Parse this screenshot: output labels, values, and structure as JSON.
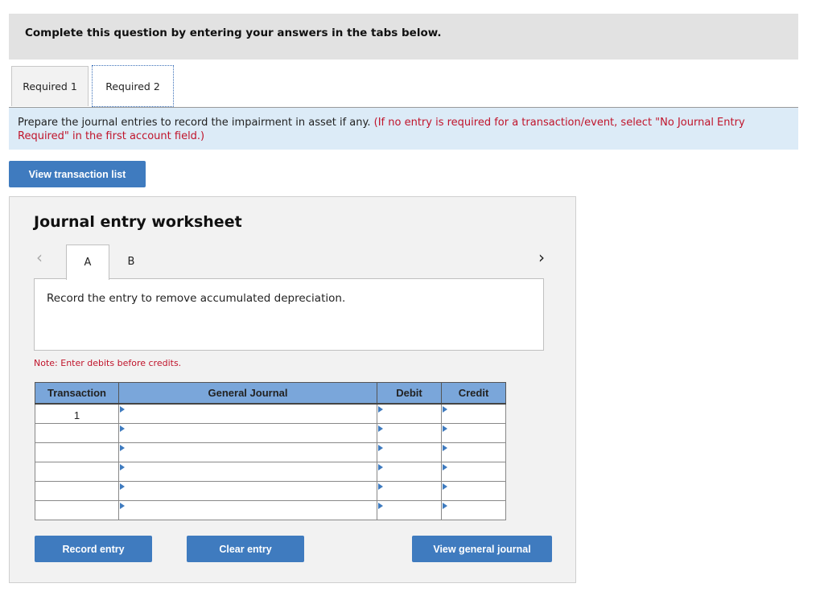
{
  "banner": {
    "text": "Complete this question by entering your answers in the tabs below."
  },
  "required_tabs": [
    {
      "label": "Required 1",
      "active": false
    },
    {
      "label": "Required 2",
      "active": true
    }
  ],
  "instructions": {
    "main": "Prepare the journal entries to record the impairment in asset if any.",
    "note": "(If no entry is required for a transaction/event, select \"No Journal Entry Required\" in the first account field.)"
  },
  "buttons": {
    "view_transaction_list": "View transaction list",
    "record_entry": "Record entry",
    "clear_entry": "Clear entry",
    "view_general_journal": "View general journal"
  },
  "worksheet": {
    "title": "Journal entry worksheet",
    "nav_prev": "<",
    "nav_next": ">",
    "tabs": [
      {
        "label": "A",
        "active": true
      },
      {
        "label": "B",
        "active": false
      }
    ],
    "description": "Record the entry to remove accumulated depreciation.",
    "note": "Note: Enter debits before credits."
  },
  "journal_table": {
    "headers": [
      "Transaction",
      "General Journal",
      "Debit",
      "Credit"
    ],
    "rows": [
      {
        "transaction": "1",
        "account": "",
        "debit": "",
        "credit": ""
      },
      {
        "transaction": "",
        "account": "",
        "debit": "",
        "credit": ""
      },
      {
        "transaction": "",
        "account": "",
        "debit": "",
        "credit": ""
      },
      {
        "transaction": "",
        "account": "",
        "debit": "",
        "credit": ""
      },
      {
        "transaction": "",
        "account": "",
        "debit": "",
        "credit": ""
      },
      {
        "transaction": "",
        "account": "",
        "debit": "",
        "credit": ""
      }
    ]
  },
  "colors": {
    "accent_blue": "#3f7bbf",
    "header_blue": "#7aa6da",
    "instruction_bg": "#dcebf7",
    "warning_red": "#c0142b"
  }
}
